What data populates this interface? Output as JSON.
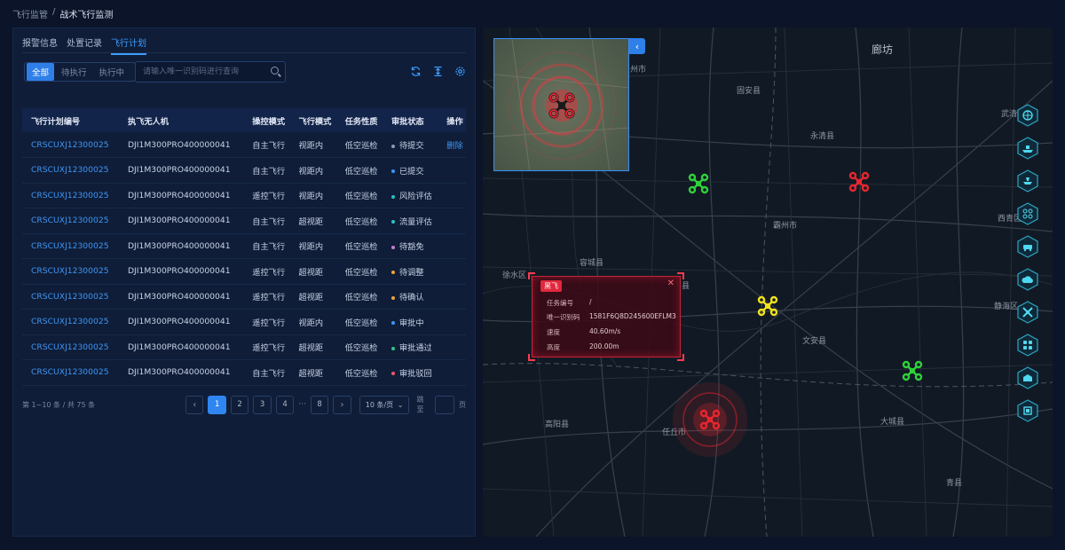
{
  "breadcrumb": {
    "parent": "飞行监管",
    "sep": "/",
    "current": "战术飞行监测"
  },
  "tabs": [
    {
      "label": "报警信息",
      "active": false
    },
    {
      "label": "处置记录",
      "active": false
    },
    {
      "label": "飞行计划",
      "active": true
    }
  ],
  "filters": [
    {
      "label": "全部",
      "active": true
    },
    {
      "label": "待执行",
      "active": false
    },
    {
      "label": "执行中",
      "active": false
    }
  ],
  "search": {
    "placeholder": "请输入唯一识别码进行查询",
    "value": ""
  },
  "table": {
    "columns": [
      "飞行计划编号",
      "执飞无人机",
      "操控模式",
      "飞行模式",
      "任务性质",
      "审批状态",
      "操作"
    ],
    "rows": [
      {
        "code": "CRSCUXJ12300025",
        "drone": "DJI1M300PRO400000041",
        "control": "自主飞行",
        "flight": "视距内",
        "nature": "低空巡检",
        "status": "待提交",
        "status_color": "#8e9ab3",
        "op": "删除"
      },
      {
        "code": "CRSCUXJ12300025",
        "drone": "DJI1M300PRO400000041",
        "control": "自主飞行",
        "flight": "视距内",
        "nature": "低空巡检",
        "status": "已提交",
        "status_color": "#3f96f3",
        "op": ""
      },
      {
        "code": "CRSCUXJ12300025",
        "drone": "DJI1M300PRO400000041",
        "control": "遥控飞行",
        "flight": "视距内",
        "nature": "低空巡检",
        "status": "风险评估",
        "status_color": "#27c4c4",
        "op": ""
      },
      {
        "code": "CRSCUXJ12300025",
        "drone": "DJI1M300PRO400000041",
        "control": "自主飞行",
        "flight": "超视距",
        "nature": "低空巡检",
        "status": "流量评估",
        "status_color": "#27c4c4",
        "op": ""
      },
      {
        "code": "CRSCUXJ12300025",
        "drone": "DJI1M300PRO400000041",
        "control": "自主飞行",
        "flight": "视距内",
        "nature": "低空巡检",
        "status": "待豁免",
        "status_color": "#c77dd6",
        "op": ""
      },
      {
        "code": "CRSCUXJ12300025",
        "drone": "DJI1M300PRO400000041",
        "control": "遥控飞行",
        "flight": "超视距",
        "nature": "低空巡检",
        "status": "待调整",
        "status_color": "#f0a33a",
        "op": ""
      },
      {
        "code": "CRSCUXJ12300025",
        "drone": "DJI1M300PRO400000041",
        "control": "遥控飞行",
        "flight": "超视距",
        "nature": "低空巡检",
        "status": "待确认",
        "status_color": "#f0a33a",
        "op": ""
      },
      {
        "code": "CRSCUXJ12300025",
        "drone": "DJI1M300PRO400000041",
        "control": "遥控飞行",
        "flight": "视距内",
        "nature": "低空巡检",
        "status": "审批中",
        "status_color": "#3f96f3",
        "op": ""
      },
      {
        "code": "CRSCUXJ12300025",
        "drone": "DJI1M300PRO400000041",
        "control": "遥控飞行",
        "flight": "超视距",
        "nature": "低空巡检",
        "status": "审批通过",
        "status_color": "#32c48a",
        "op": ""
      },
      {
        "code": "CRSCUXJ12300025",
        "drone": "DJI1M300PRO400000041",
        "control": "自主飞行",
        "flight": "超视距",
        "nature": "低空巡检",
        "status": "审批驳回",
        "status_color": "#f0566a",
        "op": ""
      }
    ]
  },
  "pagination": {
    "total_text": "第 1~10 条 / 共 75 条",
    "pages": [
      "1",
      "2",
      "3",
      "4"
    ],
    "ellipsis": "···",
    "last": "8",
    "active_page": "1",
    "page_size": "10 条/页",
    "jump_label": "跳至",
    "unit": "页"
  },
  "map": {
    "places": [
      {
        "name": "廊坊",
        "big": true
      },
      {
        "name": "州市",
        "big": false
      },
      {
        "name": "固安县",
        "big": false
      },
      {
        "name": "永清县",
        "big": false
      },
      {
        "name": "武清",
        "big": false
      },
      {
        "name": "西青区",
        "big": false
      },
      {
        "name": "霸州市",
        "big": false
      },
      {
        "name": "容城县",
        "big": false
      },
      {
        "name": "徐水区",
        "big": false
      },
      {
        "name": "县",
        "big": false
      },
      {
        "name": "静海区",
        "big": false
      },
      {
        "name": "文安县",
        "big": false
      },
      {
        "name": "高阳县",
        "big": false
      },
      {
        "name": "任丘市",
        "big": false
      },
      {
        "name": "大城县",
        "big": false
      },
      {
        "name": "青县",
        "big": false
      }
    ],
    "drones": [
      {
        "color": "#ffffff",
        "status": "alert-selected"
      },
      {
        "color": "#2fd13a",
        "status": "normal"
      },
      {
        "color": "#e8262e",
        "status": "alert"
      },
      {
        "color": "#f2e21b",
        "status": "warning"
      },
      {
        "color": "#2fd13a",
        "status": "normal"
      },
      {
        "color": "#e8262e",
        "status": "alert"
      }
    ],
    "info_card": {
      "badge": "黑飞",
      "rows": [
        {
          "key": "任务编号",
          "value": "/"
        },
        {
          "key": "唯一识别码",
          "value": "1581F6Q8D245600EFLM3"
        },
        {
          "key": "速度",
          "value": "40.60m/s"
        },
        {
          "key": "高度",
          "value": "200.00m"
        }
      ]
    },
    "right_tools": [
      "globe-icon",
      "ship-icon",
      "flight-icon",
      "drone-alert-icon",
      "vehicle-icon",
      "cloud-icon",
      "propeller-icon",
      "grid-icon",
      "building-icon",
      "layer-icon"
    ]
  },
  "colors": {
    "accent": "#2f86f0",
    "alert": "#e8262e",
    "normal": "#2fd13a",
    "warning": "#f2e21b"
  }
}
